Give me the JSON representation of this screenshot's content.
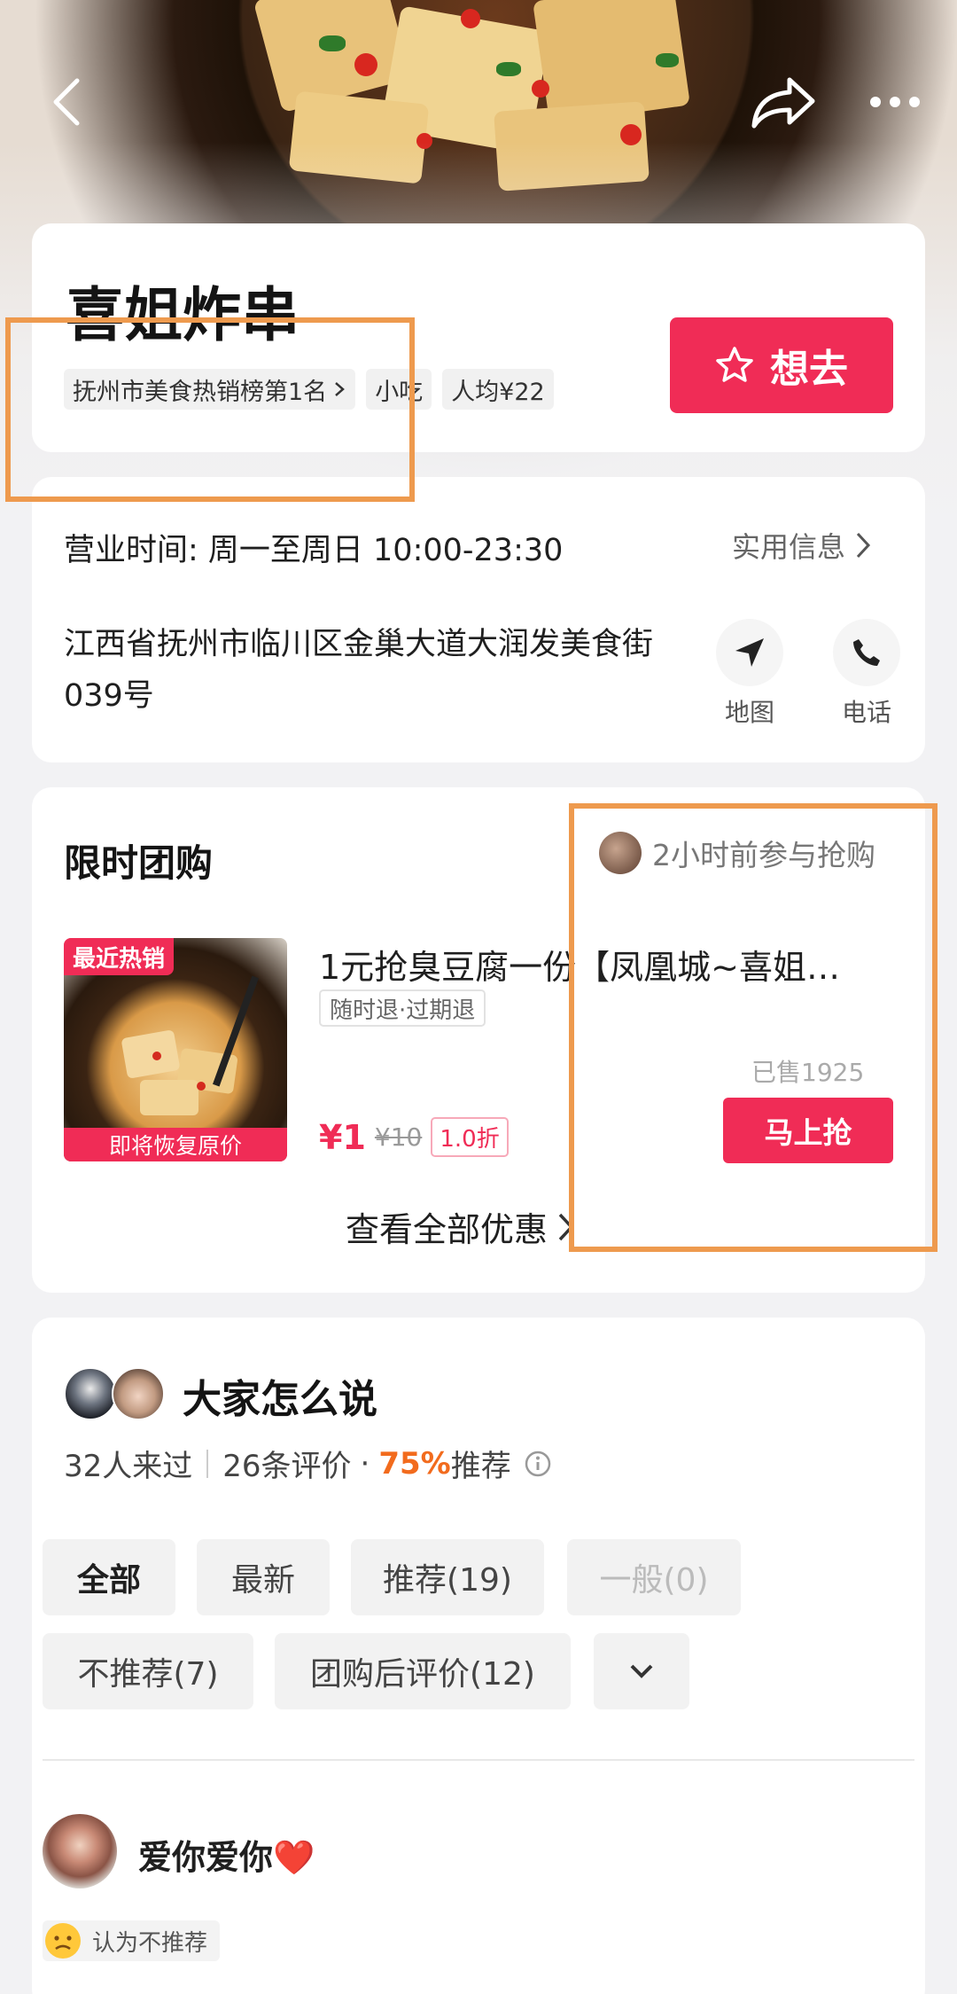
{
  "header": {
    "back_icon": "back-arrow-icon",
    "share_icon": "share-icon",
    "more_icon": "more-icon"
  },
  "shop": {
    "name": "喜姐炸串",
    "ranking_tag": "抚州市美食热销榜第1名",
    "category_tag": "小吃",
    "avg_price_tag": "人均¥22",
    "want_button": "想去",
    "accent": "#f02c56"
  },
  "info": {
    "hours": "营业时间: 周一至周日 10:00-23:30",
    "practical_info": "实用信息",
    "address": "江西省抚州市临川区金巢大道大润发美食街039号",
    "map_label": "地图",
    "phone_label": "电话"
  },
  "group_buy": {
    "title": "限时团购",
    "recent_activity": "2小时前参与抢购",
    "deal": {
      "badge_top": "最近热销",
      "badge_bottom": "即将恢复原价",
      "title": "1元抢臭豆腐一份【凤凰城~喜姐…",
      "refund_tag": "随时退·过期退",
      "price": "¥1",
      "original_price": "¥10",
      "discount": "1.0折",
      "sold": "已售1925",
      "buy_button": "马上抢"
    },
    "view_all": "查看全部优惠"
  },
  "reviews": {
    "title": "大家怎么说",
    "visited": "32人来过",
    "review_count": "26条评价",
    "recommend_pct": "75%",
    "recommend_label": "推荐",
    "filters": [
      "全部",
      "最新",
      "推荐(19)",
      "一般(0)",
      "不推荐(7)",
      "团购后评价(12)"
    ],
    "first_review": {
      "user": "爱你爱你❤️",
      "verdict": "认为不推荐"
    }
  }
}
